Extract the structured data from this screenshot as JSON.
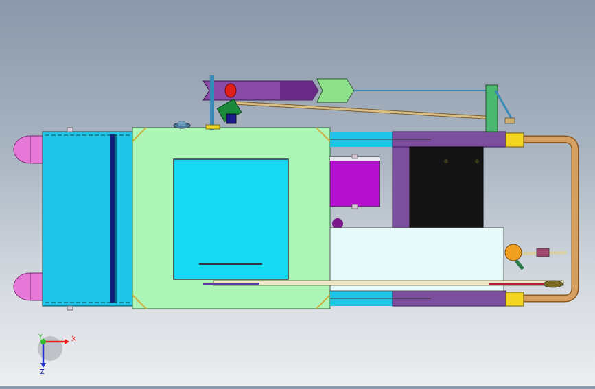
{
  "viewport": {
    "background_top": "#8a98aa",
    "background_bottom": "#eceef0"
  },
  "triad": {
    "x_label": "X",
    "y_label": "Y",
    "z_label": "Z",
    "x_color": "#e8221e",
    "y_color": "#2dbd2d",
    "z_color": "#2330c8"
  },
  "colors": {
    "tank_cyan": "#1fc4e6",
    "body_green": "#aef5b8",
    "panel_cyan": "#15d8f2",
    "rail_purple": "#7b4f9e",
    "magenta": "#b60fd0",
    "dark_block": "#141414",
    "pale_box": "#e8fbfb",
    "pink_roller": "#e678d8",
    "copper_pipe": "#d8a060",
    "yellow_clamp": "#f4d520",
    "handle_orange": "#f0a020",
    "arm_purple": "#8a4aa8",
    "arm_green": "#8ee08a",
    "red_knob": "#e0201a"
  }
}
